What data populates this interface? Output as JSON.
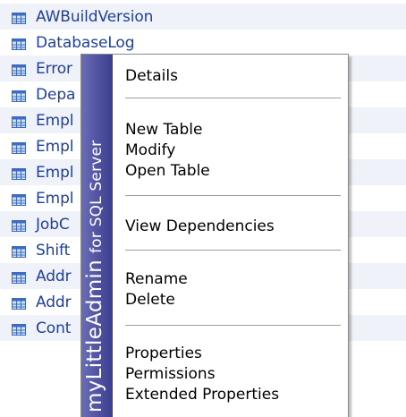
{
  "tables": [
    {
      "label": "AWBuildVersion"
    },
    {
      "label": "DatabaseLog"
    },
    {
      "label": "Error"
    },
    {
      "label": "Depa"
    },
    {
      "label": "Empl"
    },
    {
      "label": "Empl"
    },
    {
      "label": "Empl"
    },
    {
      "label": "Empl"
    },
    {
      "label": "JobC"
    },
    {
      "label": "Shift"
    },
    {
      "label": "Addr"
    },
    {
      "label": "Addr"
    },
    {
      "label": "Cont"
    }
  ],
  "context_menu": {
    "brand": {
      "main": "myLittleAdmin",
      "sub": "for SQL Server"
    },
    "items": {
      "details": "Details",
      "new_table": "New Table",
      "modify": "Modify",
      "open_table": "Open Table",
      "view_dependencies": "View Dependencies",
      "rename": "Rename",
      "delete": "Delete",
      "properties": "Properties",
      "permissions": "Permissions",
      "extended_properties": "Extended Properties"
    }
  },
  "colors": {
    "link": "#1f3f9a",
    "brand_strip": "#4d4f9f",
    "row_alt": "#eff2f8"
  }
}
